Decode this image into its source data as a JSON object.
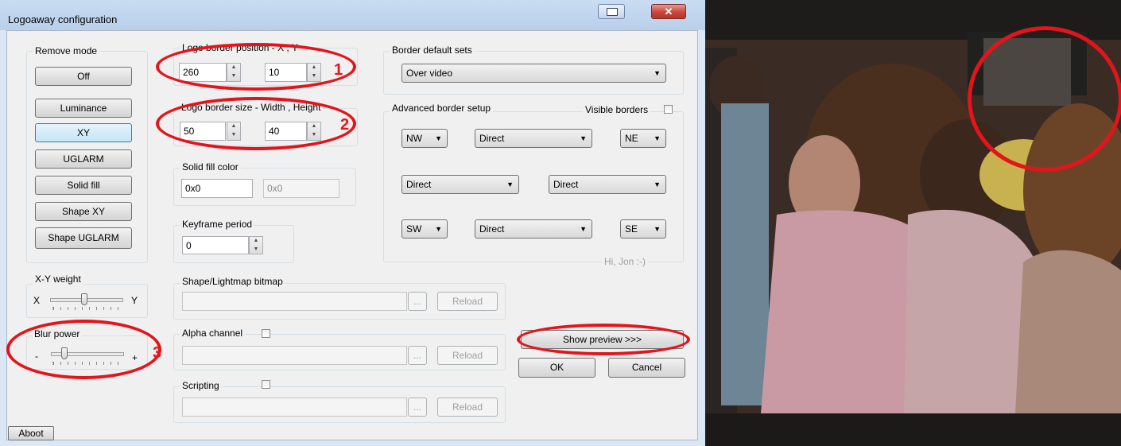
{
  "window": {
    "title": "Logoaway configuration"
  },
  "remove_mode": {
    "label": "Remove mode",
    "buttons": [
      "Off",
      "Luminance",
      "XY",
      "UGLARM",
      "Solid fill",
      "Shape XY",
      "Shape UGLARM"
    ],
    "selected": "XY"
  },
  "position": {
    "label": "Logo border position - X , Y",
    "x": "260",
    "y": "10",
    "marker": "1"
  },
  "size": {
    "label": "Logo border size - Width , Height",
    "width": "50",
    "height": "40",
    "marker": "2"
  },
  "solid_fill": {
    "label": "Solid fill color",
    "value": "0x0",
    "preview": "0x0"
  },
  "keyframe": {
    "label": "Keyframe period",
    "value": "0"
  },
  "border_defaults": {
    "label": "Border default sets",
    "value": "Over video"
  },
  "advanced": {
    "label": "Advanced border setup",
    "visible_label": "Visible borders",
    "nw": "NW",
    "ne": "NE",
    "sw": "SW",
    "se": "SE",
    "top": "Direct",
    "left": "Direct",
    "right": "Direct",
    "bottom": "Direct",
    "footer": "Hi, Jon :-)"
  },
  "xy_weight": {
    "label": "X-Y weight",
    "min": "X",
    "max": "Y",
    "level": 0.45
  },
  "blur": {
    "label": "Blur power",
    "min": "-",
    "max": "+",
    "level": 0.15,
    "marker": "3"
  },
  "shape_bitmap": {
    "label": "Shape/Lightmap bitmap",
    "browse": "...",
    "reload": "Reload"
  },
  "alpha": {
    "label": "Alpha channel",
    "browse": "...",
    "reload": "Reload"
  },
  "scripting": {
    "label": "Scripting",
    "browse": "...",
    "reload": "Reload"
  },
  "buttons": {
    "preview": "Show preview >>>",
    "ok": "OK",
    "cancel": "Cancel",
    "about": "Aboot"
  },
  "colors": {
    "annotation": "#e4141b",
    "title_bar": "#c4d8f0",
    "close": "#c9463d"
  }
}
